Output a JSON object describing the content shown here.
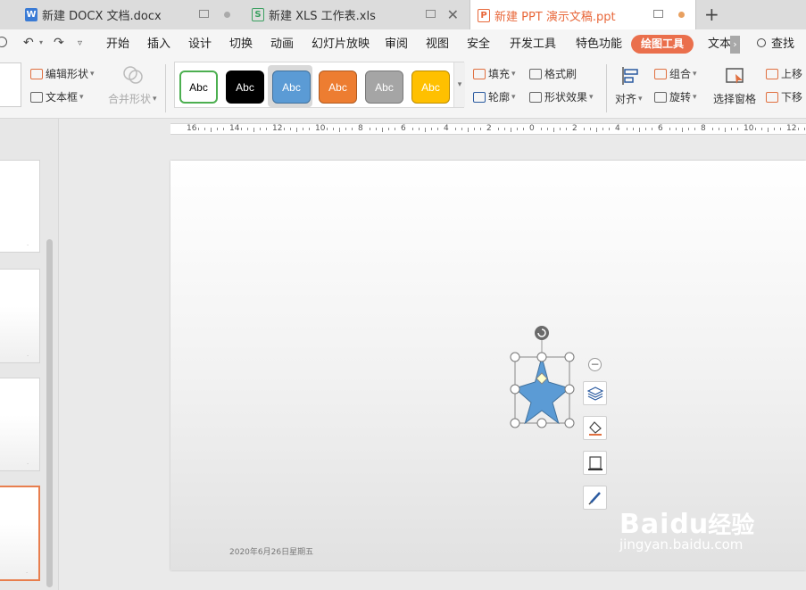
{
  "tabs": [
    {
      "label": "新建 DOCX 文档.docx",
      "icon": "W",
      "icon_color": "#3a7bd5"
    },
    {
      "label": "新建 XLS 工作表.xls",
      "icon": "S",
      "icon_color": "#3aa060"
    },
    {
      "label": "新建 PPT 演示文稿.ppt",
      "icon": "P",
      "icon_color": "#e8673a"
    }
  ],
  "new_tab_symbol": "+",
  "menu": [
    "开始",
    "插入",
    "设计",
    "切换",
    "动画",
    "幻灯片放映",
    "审阅",
    "视图",
    "安全",
    "开发工具",
    "特色功能",
    "绘图工具",
    "文本"
  ],
  "menu_more": "›",
  "search_label": "查找",
  "ribbon": {
    "edit_shape": "编辑形状",
    "text_box": "文本框",
    "merge_shape": "合并形状",
    "style_swatches": [
      {
        "label": "Abc",
        "bg": "#ffffff",
        "border": "#4caf50",
        "text": "#000000"
      },
      {
        "label": "Abc",
        "bg": "#000000",
        "border": "#000000",
        "text": "#ffffff"
      },
      {
        "label": "Abc",
        "bg": "#5b9bd5",
        "border": "#41719c",
        "text": "#ffffff"
      },
      {
        "label": "Abc",
        "bg": "#ed7d31",
        "border": "#ae5a21",
        "text": "#ffffff"
      },
      {
        "label": "Abc",
        "bg": "#a5a5a5",
        "border": "#787878",
        "text": "#ffffff"
      },
      {
        "label": "Abc",
        "bg": "#ffc000",
        "border": "#bc8c00",
        "text": "#ffffff"
      }
    ],
    "fill": "填充",
    "format_painter": "格式刷",
    "outline": "轮廓",
    "shape_effects": "形状效果",
    "align": "对齐",
    "group": "组合",
    "rotate": "旋转",
    "selection_pane": "选择窗格",
    "bring_up": "上移",
    "send_down": "下移"
  },
  "ruler_labels": [
    "16",
    "14",
    "12",
    "10",
    "8",
    "6",
    "4",
    "2",
    "0",
    "2",
    "4",
    "6",
    "8",
    "10",
    "12"
  ],
  "slide": {
    "date_text": "2020年6月26日星期五",
    "shape_name": "star",
    "shape_color": "#5b9bd5",
    "handle_color": "#ffffcc"
  },
  "side_toolbar": [
    "minus-icon",
    "layers-icon",
    "fill-bucket-icon",
    "outline-icon",
    "pen-icon"
  ],
  "watermark": {
    "brand": "Bai",
    "paw": "du",
    "suffix": "经验",
    "url": "jingyan.baidu.com"
  }
}
